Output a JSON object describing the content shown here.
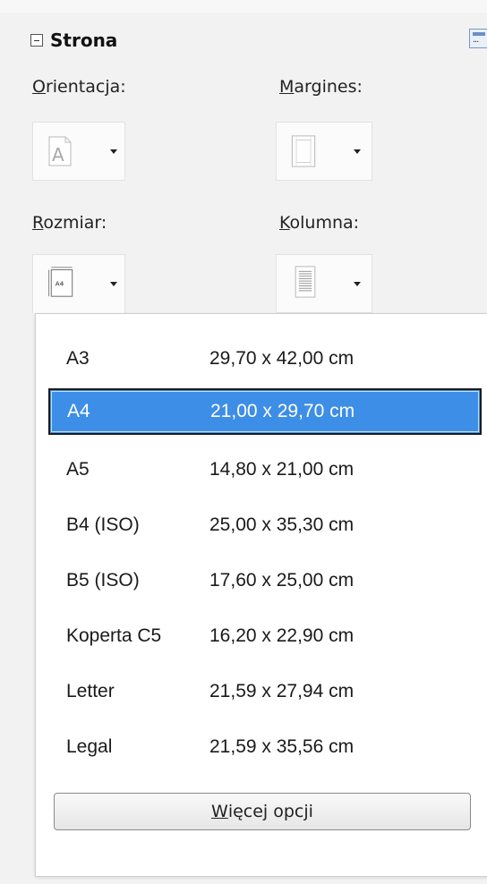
{
  "section": {
    "title": "Strona"
  },
  "orientation": {
    "label_first": "O",
    "label_rest": "rientacja:",
    "icon": "page-orientation-portrait-icon"
  },
  "margins": {
    "label_first": "M",
    "label_rest": "argines:",
    "icon": "page-margins-icon"
  },
  "size": {
    "label_first": "R",
    "label_rest": "ozmiar:",
    "icon": "page-size-a4-icon",
    "icon_text": "A4"
  },
  "columns": {
    "label_first": "K",
    "label_rest": "olumna:",
    "icon": "page-columns-icon"
  },
  "size_list": {
    "items": [
      {
        "name": "A3",
        "dims": "29,70 x 42,00 cm"
      },
      {
        "name": "A4",
        "dims": "21,00 x 29,70 cm"
      },
      {
        "name": "A5",
        "dims": "14,80 x 21,00 cm"
      },
      {
        "name": "B4 (ISO)",
        "dims": "25,00 x 35,30 cm"
      },
      {
        "name": "B5 (ISO)",
        "dims": "17,60 x 25,00 cm"
      },
      {
        "name": "Koperta C5",
        "dims": "16,20 x 22,90 cm"
      },
      {
        "name": "Letter",
        "dims": "21,59 x 27,94 cm"
      },
      {
        "name": "Legal",
        "dims": "21,59 x 35,56 cm"
      }
    ],
    "selected": "A4"
  },
  "more_options": {
    "label_first": "W",
    "label_rest": "ięcej opcji"
  },
  "colors": {
    "selection": "#3d8ee6",
    "panel_bg": "#f2f2f2"
  }
}
